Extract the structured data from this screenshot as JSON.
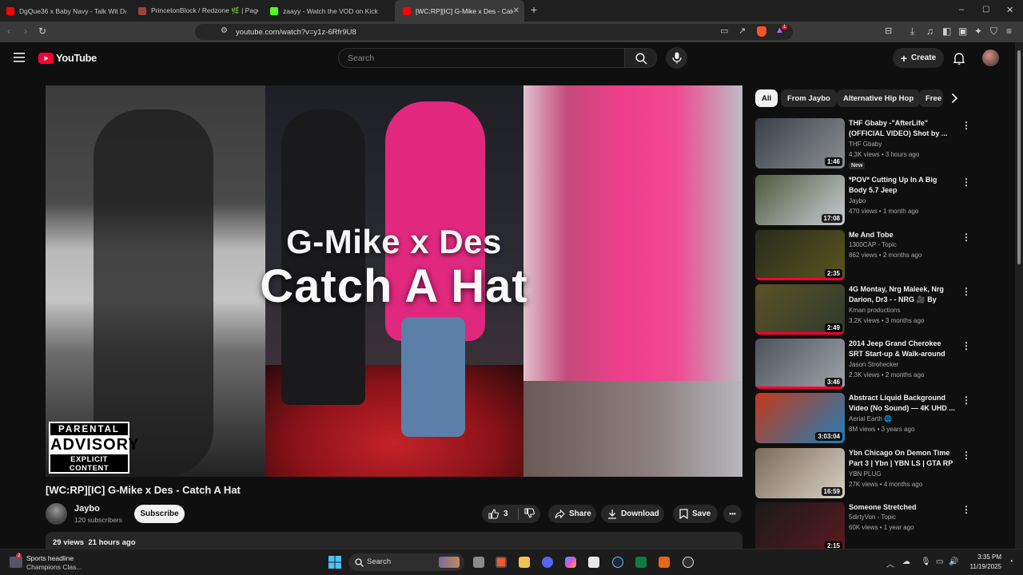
{
  "browser": {
    "tabs": [
      {
        "label": "DgQue36 x Baby Navy - Talk Wit Da",
        "favicon_color": "#ff0000"
      },
      {
        "label": "PrincetonBlock / Redzone 🌿 | Page",
        "favicon_color": "#a04040"
      },
      {
        "label": "zaayy - Watch the VOD on Kick",
        "favicon_color": "#53fc18"
      },
      {
        "label": "[WC:RP][IC] G-Mike x Des - Catc",
        "favicon_color": "#ff0000"
      }
    ],
    "new_tab": "+",
    "url": "youtube.com/watch?v=y1z-6Rfr9U8",
    "window_controls": {
      "minimize": "–",
      "restore": "▢",
      "close": "✕"
    },
    "badge_count": "1"
  },
  "youtube": {
    "logo_text": "YouTube",
    "search_placeholder": "Search",
    "create_label": "Create",
    "accent": "#ff0033"
  },
  "video": {
    "overlay_line1": "G-Mike x Des",
    "overlay_line2": "Catch A Hat",
    "advisory": {
      "line1": "PARENTAL",
      "line2": "ADVISORY",
      "line3": "EXPLICIT CONTENT"
    },
    "title": "[WC:RP][IC] G-Mike x Des - Catch A Hat",
    "channel": "Jaybo",
    "subscribers": "120 subscribers",
    "subscribe_label": "Subscribe",
    "likes": "3",
    "share_label": "Share",
    "download_label": "Download",
    "save_label": "Save",
    "more_label": "•••",
    "views": "29 views",
    "age": "21 hours ago"
  },
  "sidebar": {
    "chips": [
      "All",
      "From Jaybo",
      "Alternative Hip Hop",
      "Free"
    ],
    "recommendations": [
      {
        "title": "THF Gbaby -\"AfterLife\" (OFFICIAL VIDEO) Shot by ...",
        "channel": "THF Gbaby",
        "meta": "4.3K views • 3 hours ago",
        "duration": "1:46",
        "badge": "New",
        "thumb_colors": [
          "#394048",
          "#8c8f92"
        ]
      },
      {
        "title": "*POV* Cutting Up In A Big Body 5.7 Jeep",
        "channel": "Jaybo",
        "meta": "470 views • 1 month ago",
        "duration": "17:08",
        "badge": "",
        "thumb_colors": [
          "#4e5a3c",
          "#c9ccd3"
        ]
      },
      {
        "title": "Me And Tobe",
        "channel": "1300CAP - Topic",
        "meta": "862 views • 2 months ago",
        "duration": "2:35",
        "badge": "",
        "thumb_colors": [
          "#272c1c",
          "#5b5520"
        ]
      },
      {
        "title": "4G Montay, Nrg Maleek, Nrg Darion, Dr3 - - NRG 🎥 By Kma...",
        "channel": "Kman productions",
        "meta": "3.2K views • 3 months ago",
        "duration": "2:49",
        "badge": "",
        "thumb_colors": [
          "#5c5227",
          "#2d3a2c"
        ]
      },
      {
        "title": "2014 Jeep Grand Cherokee SRT Start-up & Walk-around (For ...",
        "channel": "Jason Strohecker",
        "meta": "2.3K views • 2 months ago",
        "duration": "3:46",
        "badge": "",
        "thumb_colors": [
          "#4d5258",
          "#9fa5ab"
        ]
      },
      {
        "title": "Abstract Liquid Background Video (No Sound) — 4K UHD ...",
        "channel": "Aerial Earth 🌐",
        "meta": "8M views • 3 years ago",
        "duration": "3:03:04",
        "badge": "",
        "thumb_colors": [
          "#c4391a",
          "#1f7fb5"
        ]
      },
      {
        "title": "Ybn Chicago On Demon Time Part 3 | Ybn | YBN LS | GTA RP ...",
        "channel": "YBN PLUG",
        "meta": "27K views • 4 months ago",
        "duration": "16:59",
        "badge": "",
        "thumb_colors": [
          "#7b6a58",
          "#d8d1c4"
        ]
      },
      {
        "title": "Someone Stretched",
        "channel": "5dirtyVon - Topic",
        "meta": "60K views • 1 year ago",
        "duration": "2:15",
        "badge": "",
        "thumb_colors": [
          "#1a1a1a",
          "#5a1a1f"
        ]
      }
    ]
  },
  "taskbar": {
    "news_title": "Sports headline",
    "news_sub": "Champions Clas...",
    "news_badge": "2",
    "search_label": "Search",
    "time": "3:35 PM",
    "date": "11/19/2025"
  }
}
